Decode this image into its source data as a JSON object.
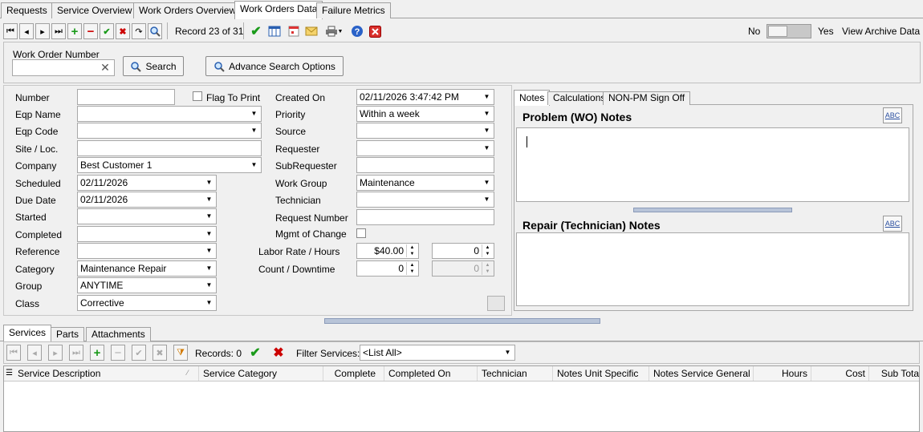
{
  "top_tabs": [
    "Requests",
    "Service Overview",
    "Work Orders Overview",
    "Work Orders Data",
    "Failure Metrics"
  ],
  "toolbar": {
    "record_text": "Record 23 of 31",
    "toggle_no": "No",
    "toggle_yes": "Yes",
    "view_archive": "View Archive Data"
  },
  "search": {
    "label": "Work Order Number",
    "value": "",
    "search_button": "Search",
    "advance_button": "Advance Search Options"
  },
  "form": {
    "number_label": "Number",
    "number_value": "",
    "flag_to_print": "Flag To Print",
    "eqp_name_label": "Eqp Name",
    "eqp_name_value": "",
    "eqp_code_label": "Eqp Code",
    "eqp_code_value": "",
    "site_label": "Site / Loc.",
    "site_value": "",
    "company_label": "Company",
    "company_value": "Best Customer 1",
    "scheduled_label": "Scheduled",
    "scheduled_value": "02/11/2026",
    "due_date_label": "Due Date",
    "due_date_value": "02/11/2026",
    "started_label": "Started",
    "started_value": "",
    "completed_label": "Completed",
    "completed_value": "",
    "reference_label": "Reference",
    "reference_value": "",
    "category_label": "Category",
    "category_value": "Maintenance Repair",
    "group_label": "Group",
    "group_value": "ANYTIME",
    "class_label": "Class",
    "class_value": "Corrective",
    "created_on_label": "Created On",
    "created_on_value": "02/11/2026 3:47:42 PM",
    "priority_label": "Priority",
    "priority_value": "Within a week",
    "source_label": "Source",
    "source_value": "",
    "requester_label": "Requester",
    "requester_value": "",
    "subrequester_label": "SubRequester",
    "subrequester_value": "",
    "work_group_label": "Work Group",
    "work_group_value": "Maintenance",
    "technician_label": "Technician",
    "technician_value": "",
    "request_number_label": "Request Number",
    "request_number_value": "",
    "mgmt_change_label": "Mgmt of Change",
    "labor_label": "Labor Rate / Hours",
    "labor_rate_value": "$40.00",
    "hours_value": "0",
    "count_label": "Count / Downtime",
    "count_value": "0",
    "downtime_value": "0"
  },
  "notes": {
    "tabs": [
      "Notes",
      "Calculations",
      "NON-PM Sign Off"
    ],
    "problem_title": "Problem (WO) Notes",
    "repair_title": "Repair (Technician) Notes",
    "spell_label": "ABC"
  },
  "bottom": {
    "tabs": [
      "Services",
      "Parts",
      "Attachments"
    ],
    "records_text": "Records: 0",
    "filter_label": "Filter Services:",
    "filter_value": "<List All>",
    "columns": [
      "Service Description",
      "Service Category",
      "Complete",
      "Completed On",
      "Technician",
      "Notes Unit Specific",
      "Notes Service General",
      "Hours",
      "Cost",
      "Sub Tota"
    ]
  }
}
